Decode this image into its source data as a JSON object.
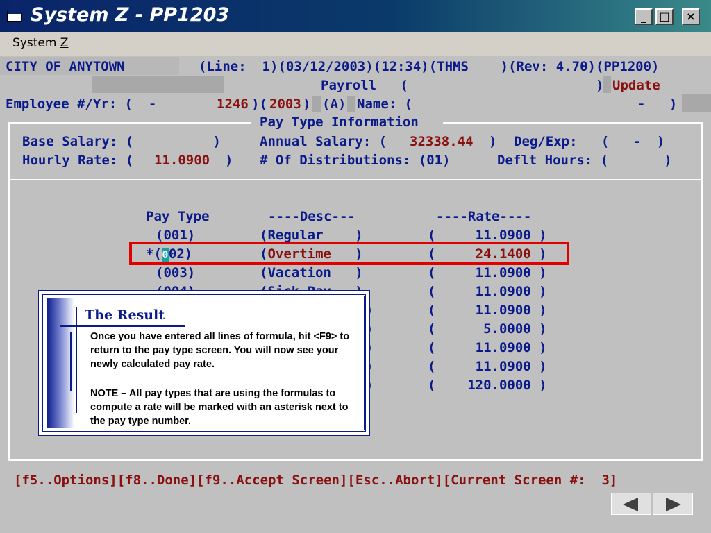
{
  "window": {
    "title": "System Z - PP1203",
    "minimize_label": "_",
    "maximize_label": "□",
    "close_label": "×"
  },
  "menu": {
    "system_prefix": "System ",
    "system_accel": "Z"
  },
  "screen": {
    "row1_left": "CITY OF ANYTOWN",
    "row1_right": "(Line:  1)(03/12/2003)(12:34)(THMS    )(Rev: 4.70)(PP1200)",
    "row2_payroll": "Payroll   (",
    "row2_close": ")",
    "row2_update": "Update",
    "emp_label": "Employee #/Yr: (  -",
    "emp_num": "1246",
    "emp_paren": ")(",
    "emp_year": "2003",
    "emp_paren2": ")",
    "emp_a": "(A)",
    "emp_name": "Name: (",
    "emp_name_end": "-   )",
    "section_title": "Pay Type Information",
    "base_salary_label": "Base Salary: (          )",
    "annual_salary_label": "Annual Salary: (",
    "annual_salary_value": "32338.44",
    "annual_salary_close": ")",
    "deg_exp": "Deg/Exp:   (   -  )",
    "hourly_rate_label": "Hourly Rate: (",
    "hourly_rate_value": "11.0900",
    "hourly_rate_close": ")",
    "distributions": "# Of Distributions: (01)",
    "deflt_hours": "Deflt Hours: (       )",
    "col_pay_type": "Pay Type",
    "col_desc": "----Desc---",
    "col_rate": "----Rate----",
    "rows": [
      {
        "type": "(001)",
        "desc": "(Regular    )",
        "rate": "(     11.0900 )"
      },
      {
        "type_prefix": "*(",
        "type_cursor": "0",
        "type_rest": "02)",
        "desc_open": "(",
        "desc": "Overtime",
        "desc_close": "   )",
        "rate_open": "(     ",
        "rate": "24.1400",
        "rate_close": " )"
      },
      {
        "type": "(003)",
        "desc": "(Vacation   )",
        "rate": "(     11.0900 )"
      },
      {
        "type": "(004)",
        "desc": "(Sick Pay   )",
        "rate": "(     11.0900 )"
      },
      {
        "rate": "(     11.0900 )"
      },
      {
        "rate": "(      5.0000 )"
      },
      {
        "rate": "(     11.0900 )"
      },
      {
        "rate": "(     11.0900 )"
      },
      {
        "rate": "(    120.0000 )"
      }
    ],
    "function_keys": "[f5..Options][f8..Done][f9..Accept Screen][Esc..Abort][Current Screen #:  3]"
  },
  "callout": {
    "title": "The Result",
    "para1": "Once you have entered all lines of formula, hit <F9> to return to the pay type screen.  You will now see your newly calculated pay rate.",
    "para2": "NOTE – All pay types that are using the formulas to compute a rate will be marked with an asterisk next to the pay type number."
  },
  "colors": {
    "terminal_text": "#0a1a8a",
    "value_text": "#8a1010",
    "highlight": "#e00000"
  }
}
